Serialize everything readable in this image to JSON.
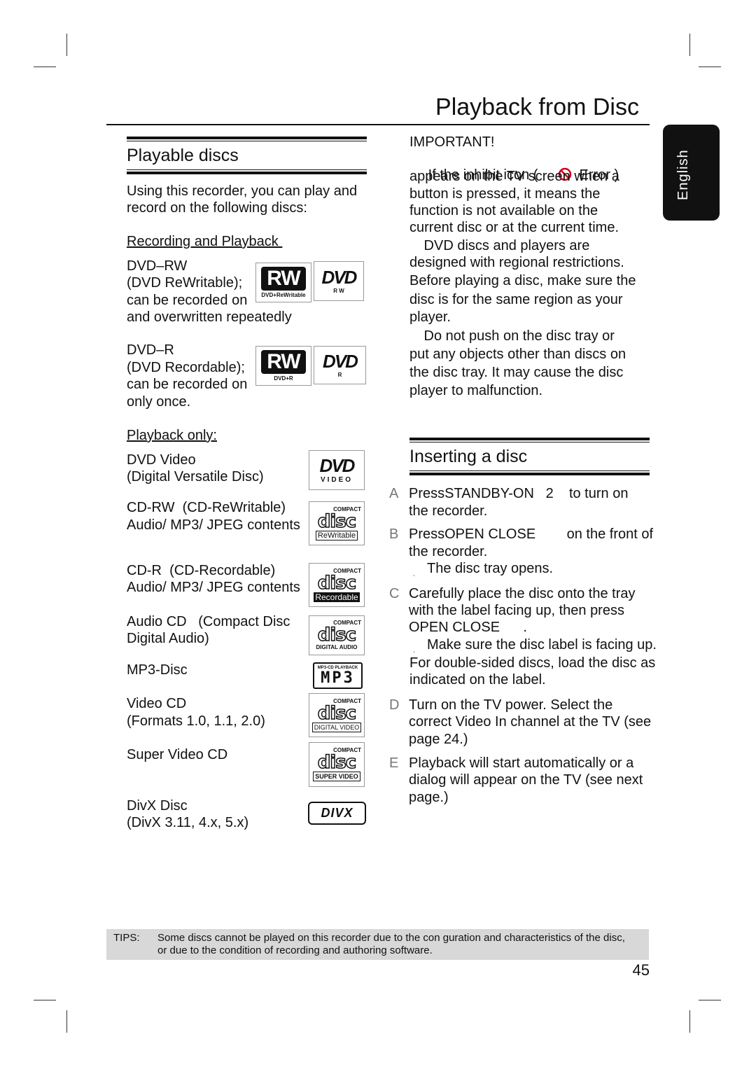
{
  "header": {
    "title": "Playback from Disc",
    "language_tab": "English"
  },
  "left": {
    "section_title": "Playable discs",
    "intro": [
      "Using this recorder, you can play and",
      "record on the following discs:"
    ],
    "rec_heading": "Recording and Playback ",
    "dvdrw": [
      "DVD–RW",
      "(DVD ReWritable);",
      "can be recorded on",
      "and overwritten repeatedly"
    ],
    "dvdr": [
      "DVD–R",
      "(DVD Recordable);",
      "can be recorded on",
      "only once."
    ],
    "play_heading": "Playback only:",
    "dvdvideo": [
      "DVD Video",
      "(Digital Versatile Disc)"
    ],
    "cdrw": [
      "CD-RW  (CD-ReWritable)",
      "Audio/ MP3/ JPEG contents"
    ],
    "cdr": [
      "CD-R  (CD-Recordable)",
      "Audio/ MP3/ JPEG contents"
    ],
    "audiocd": [
      "Audio CD   (Compact Disc",
      "Digital Audio)"
    ],
    "mp3": [
      "MP3-Disc"
    ],
    "videocd": [
      "Video CD",
      "(Formats 1.0, 1.1, 2.0)"
    ],
    "svcd": [
      "Super Video CD"
    ],
    "divx": [
      "DivX Disc",
      "(DivX 3.11, 4.x, 5.x)"
    ]
  },
  "logos": {
    "rw_plus_rw": {
      "main": "RW",
      "sub": "DVD+ReWritable"
    },
    "dvd_rw": {
      "main": "DVD",
      "sub": "R W"
    },
    "rw_plus_r": {
      "main": "RW",
      "sub": "DVD+R"
    },
    "dvd_r": {
      "main": "DVD",
      "sub": "R"
    },
    "dvd_video": {
      "main": "DVD",
      "sub": "VIDEO"
    },
    "cd_rw": {
      "top": "COMPACT",
      "main": "disc",
      "sub": "ReWritable"
    },
    "cd_r": {
      "top": "COMPACT",
      "main": "disc",
      "sub": "Recordable"
    },
    "cd_audio": {
      "top": "COMPACT",
      "main": "disc",
      "sub": "DIGITAL AUDIO"
    },
    "mp3": {
      "top": "MP3-CD PLAYBACK",
      "main": "MP3"
    },
    "video_cd": {
      "top": "COMPACT",
      "main": "disc",
      "sub": "DIGITAL VIDEO"
    },
    "svcd": {
      "top": "COMPACT",
      "main": "disc",
      "sub": "SUPER VIDEO"
    },
    "divx": {
      "main": "DIVX"
    }
  },
  "right": {
    "important_heading": "IMPORTANT!",
    "inhibit_pre": " If the inhibit icon ( ",
    "inhibit_post": " Error )",
    "inhibit_lines": [
      "appears on the TV screen when a",
      "button is pressed, it means the",
      "function is not available on the",
      "current disc or at the current time."
    ],
    "regional": [
      " DVD discs and players are",
      "designed with regional restrictions.",
      "Before playing a disc, make sure the",
      "disc is for the same region as your",
      "player."
    ],
    "tray": [
      " Do not push on the disc tray or",
      "put any objects other than discs on",
      "the disc tray. It may cause the disc",
      "player to malfunction."
    ],
    "section_title": "Inserting a disc",
    "steps": [
      {
        "letter": "A",
        "lines": [
          "PressSTANDBY-ON   2    to turn on",
          "the recorder."
        ]
      },
      {
        "letter": "B",
        "lines": [
          "PressOPEN CLOSE        on the front of",
          "the recorder."
        ],
        "note": [
          "The disc tray opens."
        ]
      },
      {
        "letter": "C",
        "lines": [
          "Carefully place the disc onto the tray",
          "with the label facing up, then press",
          "OPEN CLOSE      ."
        ],
        "note": [
          "Make sure the disc label is facing up.",
          "For double-sided discs, load the disc as",
          "indicated on the label."
        ]
      },
      {
        "letter": "D",
        "lines": [
          "Turn on the TV power. Select the",
          "correct Video In channel at the TV (see",
          "page 24.)"
        ]
      },
      {
        "letter": "E",
        "lines": [
          "Playback will start automatically or a",
          "dialog will appear on the TV (see next",
          "page.)"
        ]
      }
    ],
    "note_mark": "¸"
  },
  "tips": {
    "label": "TIPS:",
    "lines": [
      "Some discs cannot be played on this recorder due to the con guration and characteristics of the disc,",
      "or due to the condition of recording and authoring software."
    ]
  },
  "page_number": "45",
  "colors": {
    "text": "#111111",
    "tips_bg": "#d8d8d8",
    "inhibit_icon": "#d0021b",
    "tab_bg": "#111111"
  }
}
